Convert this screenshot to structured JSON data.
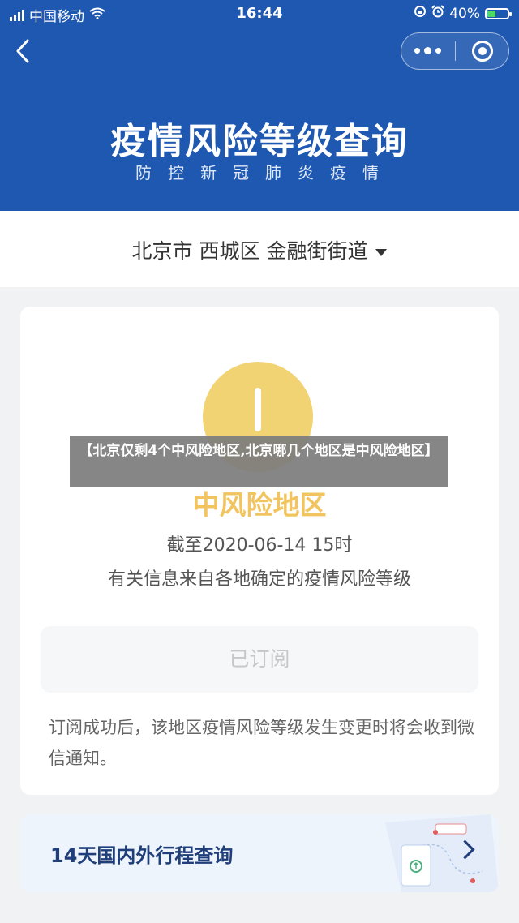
{
  "statusbar": {
    "carrier": "中国移动",
    "time": "16:44",
    "battery_percent": "40%",
    "battery_level": 0.4,
    "icons": [
      "signal-icon",
      "wifi-icon",
      "lock-rotation-icon",
      "alarm-icon",
      "battery-icon"
    ]
  },
  "header": {
    "back_icon": "chevron-left-icon",
    "capsule_icons": [
      "more-icon",
      "close-target-icon"
    ],
    "title": "疫情风险等级查询",
    "subtitle": "防控新冠肺炎疫情",
    "background_color": "#1f58b0"
  },
  "location": {
    "text": "北京市 西城区 金融街街道",
    "dropdown_icon": "caret-down-icon"
  },
  "risk": {
    "level": "中风险地区",
    "level_color": "#f2c45f",
    "as_of": "截至2020-06-14 15时",
    "source_note": "有关信息来自各地确定的疫情风险等级",
    "icon": "exclamation-icon"
  },
  "subscribe": {
    "button_label": "已订阅",
    "note": "订阅成功后，该地区疫情风险等级发生变更时将会收到微信通知。"
  },
  "itinerary": {
    "label": "14天国内外行程查询",
    "arrow_icon": "chevron-right-icon"
  },
  "overlay": {
    "caption": "【北京仅剩4个中风险地区,北京哪几个地区是中风险地区】"
  }
}
